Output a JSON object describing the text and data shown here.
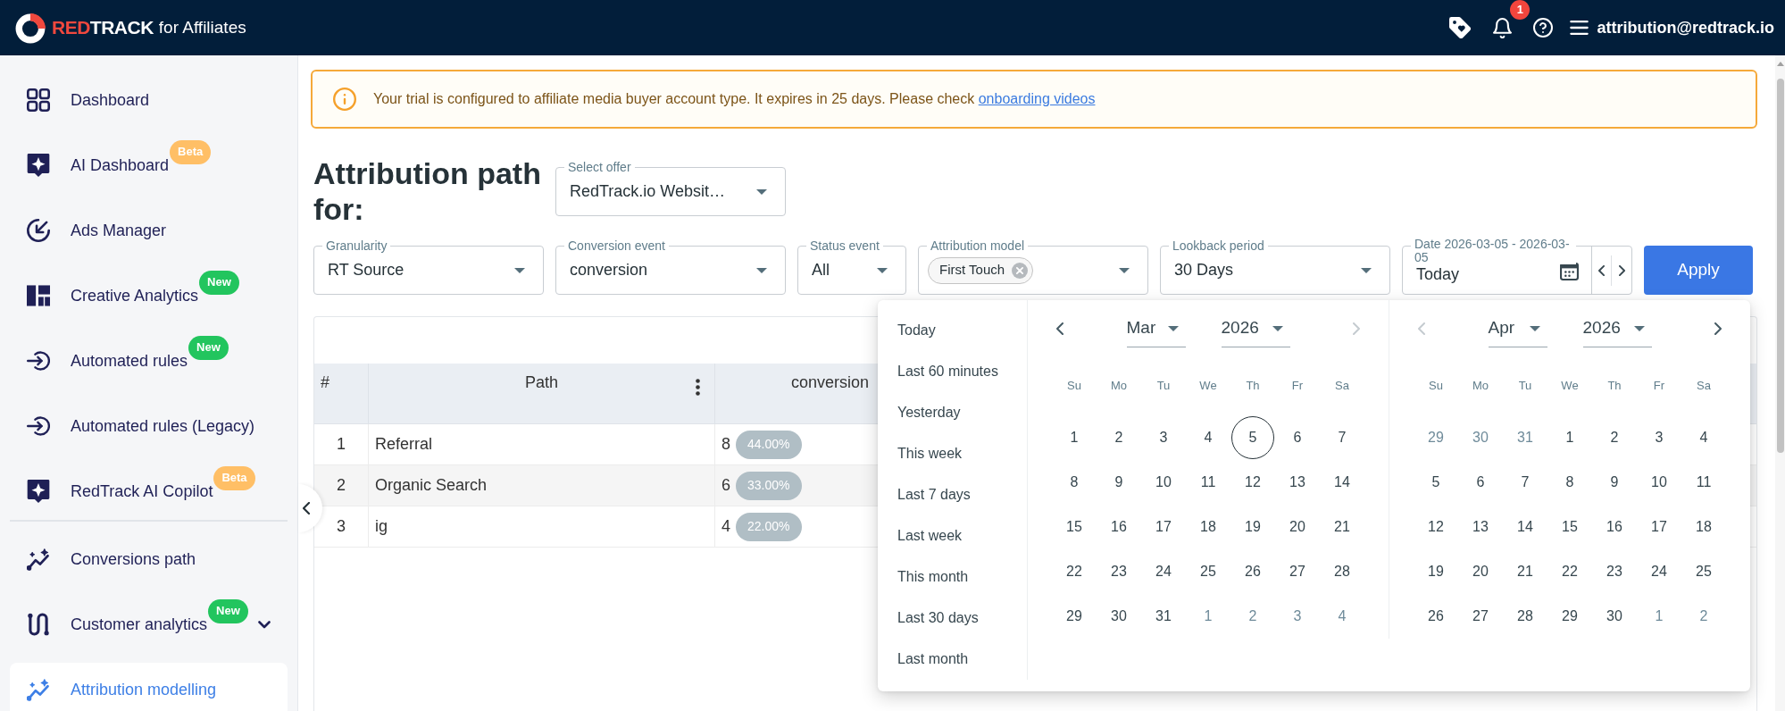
{
  "header": {
    "brand": {
      "accent": "RED",
      "name": "TRACK",
      "suffix": "for Affiliates"
    },
    "notification_count": "1",
    "user_email": "attribution@redtrack.io"
  },
  "sidebar": {
    "sections": [
      {
        "items": [
          {
            "kind": "link",
            "label": "Dashboard",
            "selected": false
          },
          {
            "kind": "link",
            "label": "AI Dashboard",
            "selected": false,
            "badge": {
              "text": "Beta",
              "color": "#ffbf66"
            }
          },
          {
            "kind": "link",
            "label": "Ads Manager",
            "selected": false
          },
          {
            "kind": "link",
            "label": "Creative Analytics",
            "selected": false,
            "badge": {
              "text": "New",
              "color": "#22c55e"
            }
          },
          {
            "kind": "link",
            "label": "Automated rules",
            "selected": false,
            "badge": {
              "text": "New",
              "color": "#22c55e"
            }
          },
          {
            "kind": "link",
            "label": "Automated rules (Legacy)",
            "selected": false
          },
          {
            "kind": "link",
            "label": "RedTrack AI Copilot",
            "selected": false,
            "badge": {
              "text": "Beta",
              "color": "#ffbf66"
            }
          }
        ]
      },
      {
        "items": [
          {
            "kind": "link",
            "label": "Conversions path",
            "selected": false
          },
          {
            "kind": "group",
            "label": "Customer analytics",
            "selected": false,
            "expanded": false,
            "badge": {
              "text": "New",
              "color": "#22c55e"
            }
          },
          {
            "kind": "link",
            "label": "Attribution modelling",
            "selected": true
          }
        ]
      }
    ]
  },
  "alert": {
    "message": "Your trial is configured to affiliate media buyer account type. It expires in 25 days. Please check",
    "link": "onboarding videos"
  },
  "page": {
    "title": "Attribution path for:",
    "offer": {
      "label": "Select offer",
      "value": "RedTrack.io Websit…"
    }
  },
  "filters": [
    {
      "kind": "select",
      "label": "Granularity",
      "value": "RT Source"
    },
    {
      "kind": "select",
      "label": "Conversion event",
      "value": "conversion"
    },
    {
      "kind": "select",
      "label": "Status event",
      "value": "All"
    },
    {
      "kind": "chips",
      "label": "Attribution model",
      "chips": [
        "First Touch"
      ]
    },
    {
      "kind": "select",
      "label": "Lookback period",
      "value": "30 Days"
    },
    {
      "kind": "date",
      "label": "Date 2026-03-05 - 2026-03-05",
      "value": "Today"
    }
  ],
  "apply_button": "Apply",
  "table": {
    "columns": [
      {
        "label": "#",
        "menu": false
      },
      {
        "label": "Path",
        "menu": true
      },
      {
        "label": "conversion",
        "menu": false
      }
    ],
    "rows": [
      {
        "index": "1",
        "path": "Referral",
        "count": "8",
        "share": "44.00%"
      },
      {
        "index": "2",
        "path": "Organic Search",
        "count": "6",
        "share": "33.00%"
      },
      {
        "index": "3",
        "path": "ig",
        "count": "4",
        "share": "22.00%"
      }
    ]
  },
  "date_picker": {
    "presets": [
      "Today",
      "Last 60 minutes",
      "Yesterday",
      "This week",
      "Last 7 days",
      "Last week",
      "This month",
      "Last 30 days",
      "Last month"
    ],
    "months": [
      {
        "month": "Mar",
        "year": "2026",
        "prev_disabled": false,
        "next_disabled": true,
        "weekdays": [
          "Su",
          "Mo",
          "Tu",
          "We",
          "Th",
          "Fr",
          "Sa"
        ],
        "weeks": [
          [
            {
              "day": "1",
              "outside": false,
              "today": false
            },
            {
              "day": "2",
              "outside": false,
              "today": false
            },
            {
              "day": "3",
              "outside": false,
              "today": false
            },
            {
              "day": "4",
              "outside": false,
              "today": false
            },
            {
              "day": "5",
              "outside": false,
              "today": true
            },
            {
              "day": "6",
              "outside": false,
              "today": false
            },
            {
              "day": "7",
              "outside": false,
              "today": false
            }
          ],
          [
            {
              "day": "8",
              "outside": false,
              "today": false
            },
            {
              "day": "9",
              "outside": false,
              "today": false
            },
            {
              "day": "10",
              "outside": false,
              "today": false
            },
            {
              "day": "11",
              "outside": false,
              "today": false
            },
            {
              "day": "12",
              "outside": false,
              "today": false
            },
            {
              "day": "13",
              "outside": false,
              "today": false
            },
            {
              "day": "14",
              "outside": false,
              "today": false
            }
          ],
          [
            {
              "day": "15",
              "outside": false,
              "today": false
            },
            {
              "day": "16",
              "outside": false,
              "today": false
            },
            {
              "day": "17",
              "outside": false,
              "today": false
            },
            {
              "day": "18",
              "outside": false,
              "today": false
            },
            {
              "day": "19",
              "outside": false,
              "today": false
            },
            {
              "day": "20",
              "outside": false,
              "today": false
            },
            {
              "day": "21",
              "outside": false,
              "today": false
            }
          ],
          [
            {
              "day": "22",
              "outside": false,
              "today": false
            },
            {
              "day": "23",
              "outside": false,
              "today": false
            },
            {
              "day": "24",
              "outside": false,
              "today": false
            },
            {
              "day": "25",
              "outside": false,
              "today": false
            },
            {
              "day": "26",
              "outside": false,
              "today": false
            },
            {
              "day": "27",
              "outside": false,
              "today": false
            },
            {
              "day": "28",
              "outside": false,
              "today": false
            }
          ],
          [
            {
              "day": "29",
              "outside": false,
              "today": false
            },
            {
              "day": "30",
              "outside": false,
              "today": false
            },
            {
              "day": "31",
              "outside": false,
              "today": false
            },
            {
              "day": "1",
              "outside": true,
              "today": false
            },
            {
              "day": "2",
              "outside": true,
              "today": false
            },
            {
              "day": "3",
              "outside": true,
              "today": false
            },
            {
              "day": "4",
              "outside": true,
              "today": false
            }
          ]
        ]
      },
      {
        "month": "Apr",
        "year": "2026",
        "prev_disabled": true,
        "next_disabled": false,
        "weekdays": [
          "Su",
          "Mo",
          "Tu",
          "We",
          "Th",
          "Fr",
          "Sa"
        ],
        "weeks": [
          [
            {
              "day": "29",
              "outside": true,
              "today": false
            },
            {
              "day": "30",
              "outside": true,
              "today": false
            },
            {
              "day": "31",
              "outside": true,
              "today": false
            },
            {
              "day": "1",
              "outside": false,
              "today": false
            },
            {
              "day": "2",
              "outside": false,
              "today": false
            },
            {
              "day": "3",
              "outside": false,
              "today": false
            },
            {
              "day": "4",
              "outside": false,
              "today": false
            }
          ],
          [
            {
              "day": "5",
              "outside": false,
              "today": false
            },
            {
              "day": "6",
              "outside": false,
              "today": false
            },
            {
              "day": "7",
              "outside": false,
              "today": false
            },
            {
              "day": "8",
              "outside": false,
              "today": false
            },
            {
              "day": "9",
              "outside": false,
              "today": false
            },
            {
              "day": "10",
              "outside": false,
              "today": false
            },
            {
              "day": "11",
              "outside": false,
              "today": false
            }
          ],
          [
            {
              "day": "12",
              "outside": false,
              "today": false
            },
            {
              "day": "13",
              "outside": false,
              "today": false
            },
            {
              "day": "14",
              "outside": false,
              "today": false
            },
            {
              "day": "15",
              "outside": false,
              "today": false
            },
            {
              "day": "16",
              "outside": false,
              "today": false
            },
            {
              "day": "17",
              "outside": false,
              "today": false
            },
            {
              "day": "18",
              "outside": false,
              "today": false
            }
          ],
          [
            {
              "day": "19",
              "outside": false,
              "today": false
            },
            {
              "day": "20",
              "outside": false,
              "today": false
            },
            {
              "day": "21",
              "outside": false,
              "today": false
            },
            {
              "day": "22",
              "outside": false,
              "today": false
            },
            {
              "day": "23",
              "outside": false,
              "today": false
            },
            {
              "day": "24",
              "outside": false,
              "today": false
            },
            {
              "day": "25",
              "outside": false,
              "today": false
            }
          ],
          [
            {
              "day": "26",
              "outside": false,
              "today": false
            },
            {
              "day": "27",
              "outside": false,
              "today": false
            },
            {
              "day": "28",
              "outside": false,
              "today": false
            },
            {
              "day": "29",
              "outside": false,
              "today": false
            },
            {
              "day": "30",
              "outside": false,
              "today": false
            },
            {
              "day": "1",
              "outside": true,
              "today": false
            },
            {
              "day": "2",
              "outside": true,
              "today": false
            }
          ]
        ]
      }
    ]
  }
}
